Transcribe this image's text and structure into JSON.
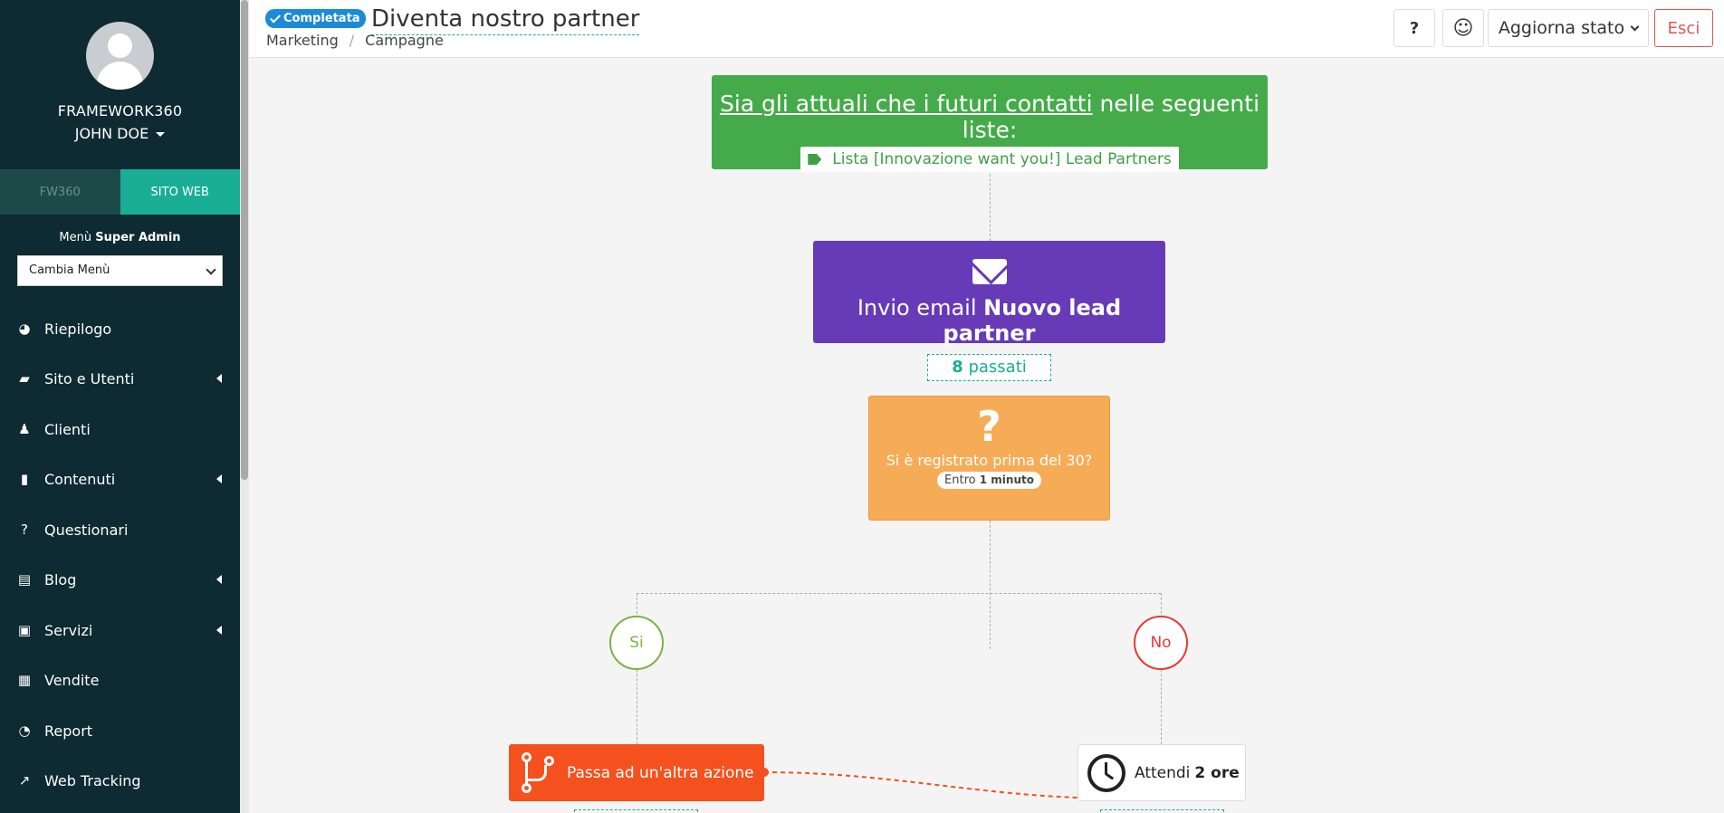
{
  "sidebar": {
    "org": "FRAMEWORK360",
    "user": "JOHN DOE",
    "tabs": [
      "FW360",
      "SITO WEB"
    ],
    "menu_title_prefix": "Menù",
    "menu_title_role": "Super Admin",
    "menu_select": "Cambia Menù",
    "items": [
      {
        "label": "Riepilogo",
        "icon": "dashboard-icon",
        "glyph": "◕",
        "submenu": false
      },
      {
        "label": "Sito e Utenti",
        "icon": "briefcase-icon",
        "glyph": "▰",
        "submenu": true
      },
      {
        "label": "Clienti",
        "icon": "person-icon",
        "glyph": "♟",
        "submenu": false
      },
      {
        "label": "Contenuti",
        "icon": "file-icon",
        "glyph": "▮",
        "submenu": true
      },
      {
        "label": "Questionari",
        "icon": "question-icon",
        "glyph": "?",
        "submenu": false
      },
      {
        "label": "Blog",
        "icon": "document-icon",
        "glyph": "▤",
        "submenu": true
      },
      {
        "label": "Servizi",
        "icon": "suitcase-icon",
        "glyph": "▣",
        "submenu": true
      },
      {
        "label": "Vendite",
        "icon": "calculator-icon",
        "glyph": "▦",
        "submenu": false
      },
      {
        "label": "Report",
        "icon": "pie-chart-icon",
        "glyph": "◔",
        "submenu": false
      },
      {
        "label": "Web Tracking",
        "icon": "line-chart-icon",
        "glyph": "↗",
        "submenu": false
      }
    ]
  },
  "header": {
    "badge": "Completata",
    "title": "Diventa nostro partner",
    "breadcrumb": [
      "Marketing",
      "Campagne"
    ],
    "help_label": "?",
    "smile_label": "☺",
    "state_label": "Aggiorna stato",
    "exit_label": "Esci"
  },
  "flow": {
    "trigger_underlined": "Sia gli attuali che i futuri contatti",
    "trigger_rest": "nelle seguenti liste:",
    "trigger_tag": "Lista [Innovazione want you!] Lead Partners",
    "email_prefix": "Invio email",
    "email_name": "Nuovo lead partner",
    "passed_count": "8",
    "passed_label": "passati",
    "condition_text": "Si è registrato prima del 30?",
    "condition_within": "Entro",
    "condition_time": "1 minuto",
    "yes_label": "Si",
    "no_label": "No",
    "action_label": "Passa ad un'altra azione",
    "wait_prefix": "Attendi",
    "wait_time": "2 ore"
  },
  "colors": {
    "sidebar_bg": "#0e2a33",
    "accent": "#1aad96",
    "trigger": "#45ab4a",
    "email": "#673ab7",
    "condition": "#f6ac57",
    "action": "#f4511e",
    "yes": "#7cb342",
    "no": "#e53935",
    "badge": "#1b8bd8",
    "exit": "#e55353"
  }
}
